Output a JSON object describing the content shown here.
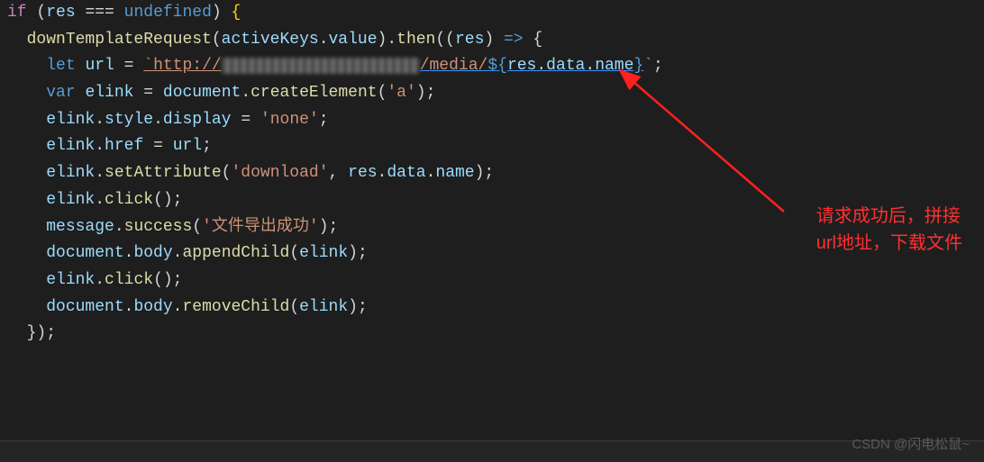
{
  "code": {
    "line1": {
      "kw_if": "if",
      "paren_open": "(",
      "res": "res",
      "eq": "===",
      "undef": "undefined",
      "paren_close": ")",
      "brace": "{"
    },
    "line2": {
      "indent": "  ",
      "func": "downTemplateRequest",
      "arg_obj": "activeKeys",
      "arg_prop": "value",
      "then": "then",
      "cb_arg": "res",
      "arrow": "=>",
      "brace": "{"
    },
    "line3": {
      "indent": "    ",
      "kw": "let",
      "var": "url",
      "eq": "=",
      "str_open": "`http://",
      "str_mid": "/media/",
      "tmpl_open": "${",
      "res": "res",
      "data": "data",
      "name": "name",
      "tmpl_close": "}",
      "str_close": "`",
      "semi": ";"
    },
    "line4": {
      "indent": "    ",
      "kw": "var",
      "var": "elink",
      "eq": "=",
      "obj": "document",
      "func": "createElement",
      "arg": "'a'",
      "semi": ";"
    },
    "line5": {
      "indent": "    ",
      "obj": "elink",
      "p1": "style",
      "p2": "display",
      "eq": "=",
      "val": "'none'",
      "semi": ";"
    },
    "line6": {
      "indent": "    ",
      "obj": "elink",
      "prop": "href",
      "eq": "=",
      "val": "url",
      "semi": ";"
    },
    "line7": {
      "indent": "    ",
      "obj": "elink",
      "func": "setAttribute",
      "arg1": "'download'",
      "comma": ",",
      "res": "res",
      "data": "data",
      "name": "name",
      "semi": ";"
    },
    "line8": {
      "indent": "    ",
      "obj": "elink",
      "func": "click",
      "semi": ";"
    },
    "line9": {
      "indent": "    ",
      "obj": "message",
      "func": "success",
      "arg": "'文件导出成功'",
      "semi": ";"
    },
    "line10": {
      "indent": "    ",
      "obj": "document",
      "body": "body",
      "func": "appendChild",
      "arg": "elink",
      "semi": ";"
    },
    "line11": {
      "indent": "    ",
      "obj": "elink",
      "func": "click",
      "semi": ";"
    },
    "line12": {
      "indent": "    ",
      "obj": "document",
      "body": "body",
      "func": "removeChild",
      "arg": "elink",
      "semi": ";"
    },
    "line13": {
      "indent": "  ",
      "brace": "}",
      "paren": ")",
      "semi": ";"
    }
  },
  "annotation": {
    "line1": "请求成功后，拼接",
    "line2": "url地址，下载文件"
  },
  "watermark": "CSDN @闪电松鼠~"
}
